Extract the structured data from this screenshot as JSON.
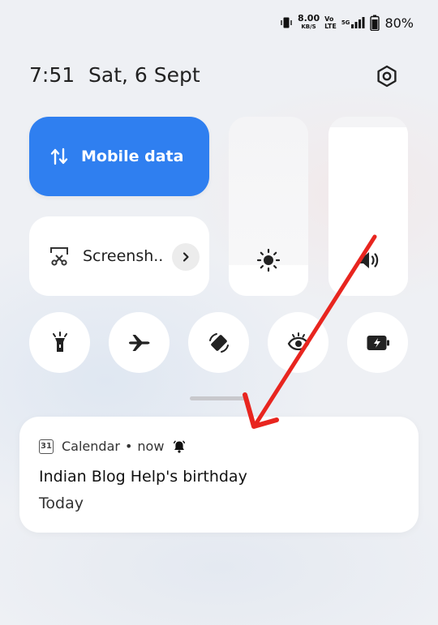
{
  "status_bar": {
    "speed_value": "8.00",
    "speed_unit": "KB/S",
    "volte_top": "Vo",
    "volte_bottom": "LTE",
    "network": "5G",
    "battery": "80%"
  },
  "header": {
    "time": "7:51",
    "date": "Sat, 6 Sept"
  },
  "tiles": {
    "mobile_data_label": "Mobile data",
    "screenshot_label": "Screensh.."
  },
  "sliders": {
    "brightness_level": 0.17,
    "volume_level": 0.94
  },
  "toggles": [
    "flashlight-icon",
    "airplane-mode-icon",
    "auto-rotate-icon",
    "eye-comfort-icon",
    "battery-saver-icon"
  ],
  "notification": {
    "calendar_day": "31",
    "app": "Calendar",
    "separator": "•",
    "when": "now",
    "title": "Indian Blog Help's birthday",
    "subtitle": "Today"
  },
  "colors": {
    "accent": "#2f7ff0",
    "annotation_arrow": "#e8251f"
  }
}
